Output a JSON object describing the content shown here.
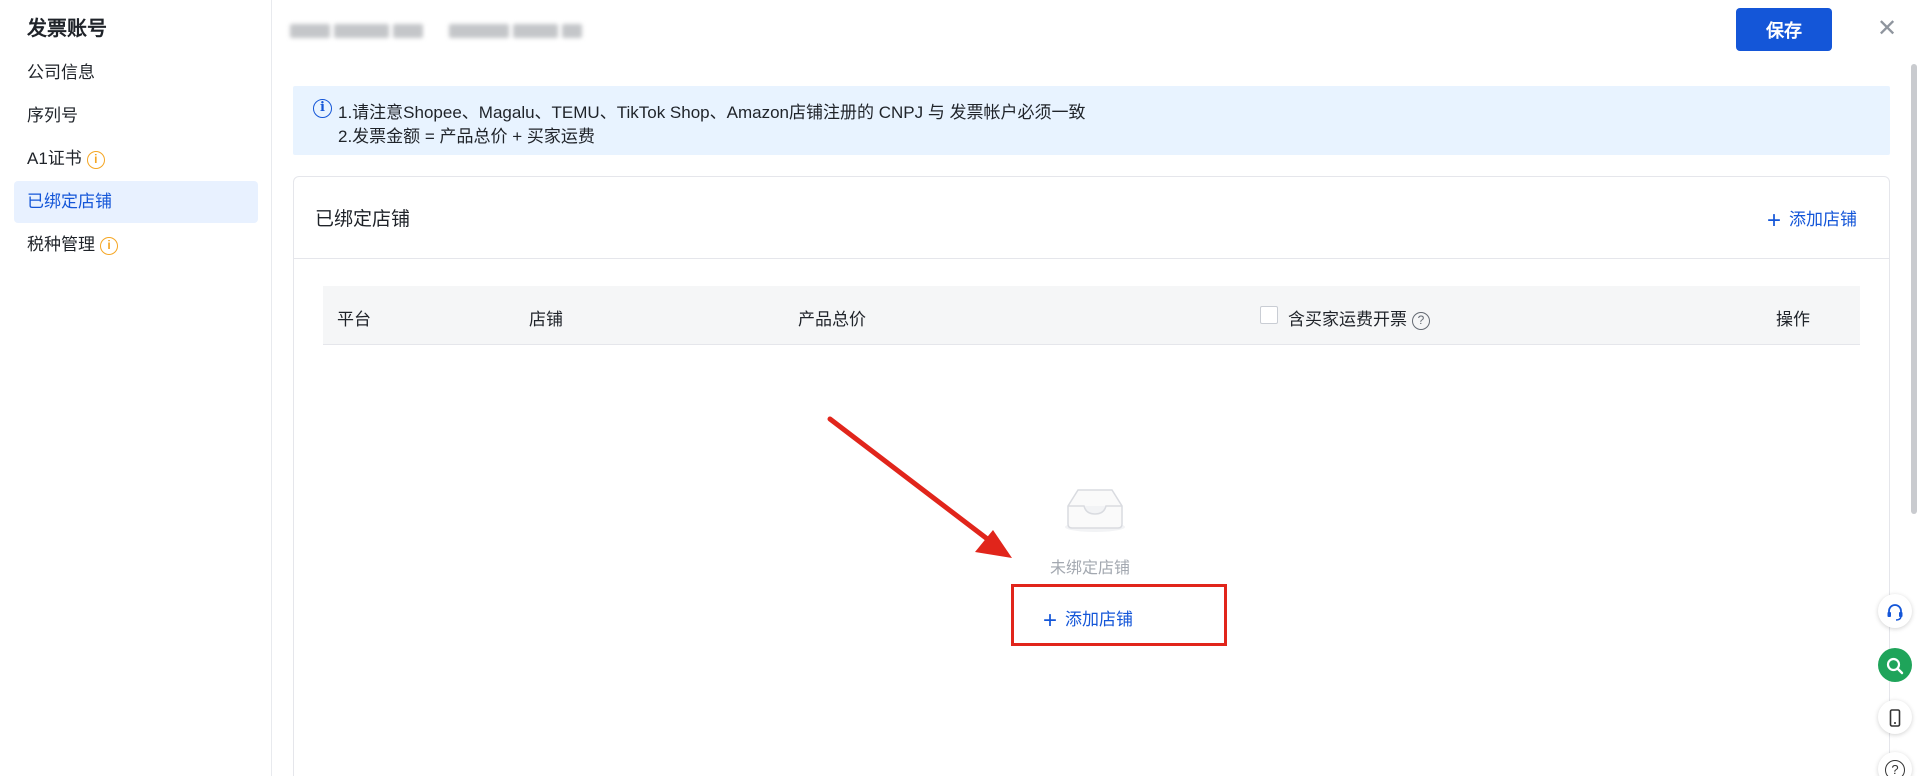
{
  "sidebar": {
    "title": "发票账号",
    "items": [
      {
        "label": "公司信息",
        "warning": false
      },
      {
        "label": "序列号",
        "warning": false
      },
      {
        "label": "A1证书",
        "warning": true
      },
      {
        "label": "已绑定店铺",
        "warning": false,
        "active": true
      },
      {
        "label": "税种管理",
        "warning": true
      }
    ]
  },
  "header": {
    "save_label": "保存",
    "close_icon": "close-icon"
  },
  "notice": {
    "line1": "1.请注意Shopee、Magalu、TEMU、TikTok Shop、Amazon店铺注册的 CNPJ 与 发票帐户必须一致",
    "line2": "2.发票金额 = 产品总价 + 买家运费"
  },
  "card": {
    "title": "已绑定店铺",
    "add_label": "添加店铺"
  },
  "table": {
    "columns": [
      "平台",
      "店铺",
      "产品总价",
      "含买家运费开票",
      "操作"
    ],
    "checkbox_checked": false
  },
  "empty": {
    "text": "未绑定店铺",
    "add_label": "添加店铺"
  },
  "colors": {
    "primary": "#1456d8",
    "highlight_box": "#e1251b",
    "warning": "#f5a623"
  }
}
